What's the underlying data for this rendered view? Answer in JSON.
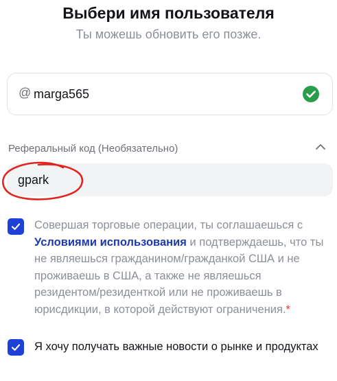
{
  "header": {
    "title": "Выбери имя пользователя",
    "subtitle": "Ты можешь обновить его позже."
  },
  "username": {
    "prefix": "@",
    "value": "marga565",
    "status_icon": "check-circle-icon",
    "status_color": "#2a9d4a"
  },
  "referral": {
    "label": "Реферальный код (Необязательно)",
    "toggle_icon": "chevron-up-icon",
    "value": "gpark",
    "annotation_color": "#e0251f"
  },
  "consent": {
    "checked": true,
    "text_before": "Совершая торговые операции, ты соглашаешься с ",
    "link": "Условиями использования",
    "text_after": " и подтверждаешь, что ты не являешься гражданином/гражданкой США и не проживаешь в США, а также не являешься резидентом/резиденткой или не проживаешь в юрисдикции, в которой действуют ограничения.",
    "required_mark": "*"
  },
  "newsletter": {
    "checked": true,
    "text": "Я хочу получать важные новости о рынке и продуктах"
  },
  "colors": {
    "accent": "#1e40d6",
    "link": "#1e3aa8",
    "required": "#e53935"
  }
}
